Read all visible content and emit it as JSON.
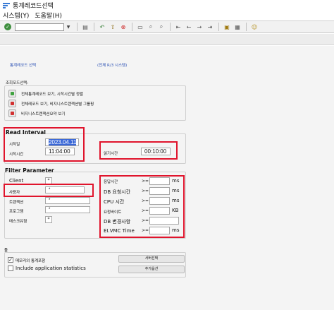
{
  "window": {
    "title": "통계레코드선택",
    "logo_icon": "sap-logo-icon"
  },
  "menu": {
    "items": [
      "시스템(Y)",
      "도움말(H)"
    ]
  },
  "toolbar": {
    "command_field": "",
    "icons": [
      "enter-icon",
      "save-icon",
      "back-icon",
      "exit-icon",
      "cancel-icon",
      "print-icon",
      "find-icon",
      "find-next-icon",
      "first-page-icon",
      "prev-page-icon",
      "next-page-icon",
      "last-page-icon",
      "new-session-icon",
      "shortcut-icon",
      "help-icon"
    ]
  },
  "header": {
    "left_link": "통계레코드 선택",
    "right_link": "(전체 R/3 시스템)"
  },
  "view_mode": {
    "label": "조회모드선택:",
    "options": [
      {
        "label": "전체통계레코드 보기, 시작시간별 정렬",
        "color": "#3fa23f"
      },
      {
        "label": "전체레코드 보기, 비지니스트랜잭션별 그룹핑",
        "color": "#d23030"
      },
      {
        "label": "비지니스트랜잭션요약 보기",
        "color": "#d23030"
      }
    ]
  },
  "read_interval": {
    "title": "Read Interval",
    "start_date_label": "시작일",
    "start_date": "2023.04.11",
    "start_time_label": "시작시간",
    "start_time": "11:04:00",
    "read_time_label": "읽기시간",
    "read_time": "00:10:00"
  },
  "filter": {
    "title": "Filter Parameter",
    "left": [
      {
        "label": "Client",
        "value": "*"
      },
      {
        "label": "사용자",
        "value": "*"
      },
      {
        "label": "트랜잭션",
        "value": "*"
      },
      {
        "label": "프로그램",
        "value": "*"
      },
      {
        "label": "태스크유형",
        "value": "*"
      }
    ],
    "right": [
      {
        "label": "응답시간",
        "op": ">=",
        "unit": "ms"
      },
      {
        "label": "DB 요청시간",
        "op": ">=",
        "unit": "ms"
      },
      {
        "label": "CPU 시간",
        "op": ">=",
        "unit": "ms"
      },
      {
        "label": "요청바이트",
        "op": ">=",
        "unit": "KB"
      },
      {
        "label": "DB 변경사항",
        "op": ">=",
        "unit": ""
      },
      {
        "label": "EI.VMC Time",
        "op": ">=",
        "unit": "ms"
      }
    ]
  },
  "options": {
    "title": "툴",
    "memory_stats": {
      "label": "메모리의 통계포함",
      "checked": true
    },
    "app_stats": {
      "label": "Include application statistics",
      "checked": false
    },
    "server_button": "서버선택",
    "more_button": "추가옵션"
  },
  "colors": {
    "highlight": "#e0142c",
    "link": "#2a4fb3",
    "selection": "#3a68d8"
  }
}
